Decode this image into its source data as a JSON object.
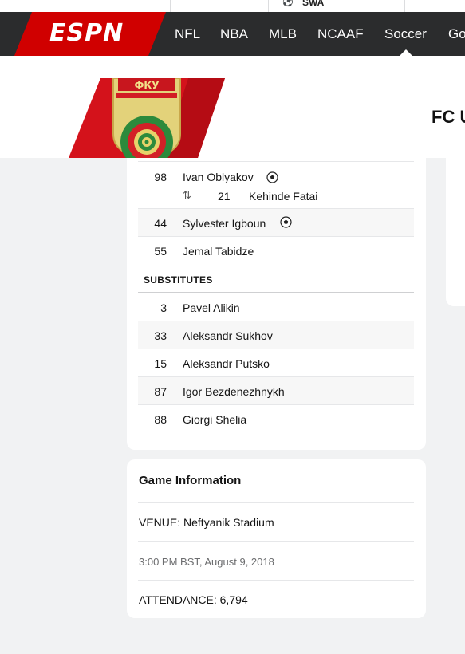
{
  "top_strip": {
    "team_abbr": "SWA"
  },
  "nav": {
    "logo": "ESPN",
    "links": [
      "NFL",
      "NBA",
      "MLB",
      "NCAAF",
      "Soccer",
      "Go"
    ],
    "active": "Soccer",
    "colors": {
      "bar": "#2b2c2d",
      "logo_red": "#d00000"
    }
  },
  "match_header": {
    "team_name": "FC U"
  },
  "lineup": {
    "starters": [
      {
        "number": "98",
        "name": "Ivan Oblyakov",
        "goal_icon": "soccer-ball-icon",
        "sub_icon": "substitution-arrows-icon",
        "sub_number": "21",
        "sub_name": "Kehinde Fatai"
      },
      {
        "number": "44",
        "name": "Sylvester Igboun",
        "goal_icon": "soccer-ball-icon"
      },
      {
        "number": "55",
        "name": "Jemal Tabidze"
      }
    ],
    "substitutes_heading": "SUBSTITUTES",
    "substitutes": [
      {
        "number": "3",
        "name": "Pavel Alikin"
      },
      {
        "number": "33",
        "name": "Aleksandr Sukhov"
      },
      {
        "number": "15",
        "name": "Aleksandr Putsko"
      },
      {
        "number": "87",
        "name": "Igor Bezdenezhnykh"
      },
      {
        "number": "88",
        "name": "Giorgi Shelia"
      }
    ]
  },
  "game_info": {
    "title": "Game Information",
    "venue": "VENUE: Neftyanik Stadium",
    "datetime": "3:00 PM BST, August 9, 2018",
    "attendance": "ATTENDANCE: 6,794"
  }
}
